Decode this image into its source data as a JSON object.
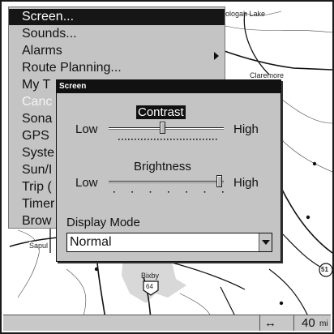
{
  "menu": {
    "items": [
      {
        "label": "Screen...",
        "state": "selected"
      },
      {
        "label": "Sounds...",
        "state": "normal"
      },
      {
        "label": "Alarms",
        "state": "normal",
        "has_submenu": true
      },
      {
        "label": "Route Planning...",
        "state": "normal"
      },
      {
        "label": "My T",
        "state": "normal"
      },
      {
        "label": "Canc",
        "state": "disabled"
      },
      {
        "label": "Sona",
        "state": "normal"
      },
      {
        "label": "GPS",
        "state": "normal"
      },
      {
        "label": "Syste",
        "state": "normal"
      },
      {
        "label": "Sun/I",
        "state": "normal"
      },
      {
        "label": "Trip (",
        "state": "normal"
      },
      {
        "label": "Timer",
        "state": "normal"
      },
      {
        "label": "Brow",
        "state": "normal"
      }
    ]
  },
  "dialog": {
    "title": "Screen",
    "contrast": {
      "label": "Contrast",
      "low_label": "Low",
      "high_label": "High",
      "level": 0.47
    },
    "brightness": {
      "label": "Brightness",
      "low_label": "Low",
      "high_label": "High",
      "level": 1.0
    },
    "display_mode": {
      "label": "Display Mode",
      "value": "Normal"
    }
  },
  "map": {
    "labels": {
      "lake": "ologah Lake",
      "claremore": "Claremore",
      "sapulpa": "Sapul",
      "bixby": "Bixby",
      "highway_64": "64",
      "highway_51": "51"
    }
  },
  "status_bar": {
    "scale_value": "40",
    "scale_unit": "mi"
  },
  "colors": {
    "menu_bg": "#c4c4c4",
    "selection": "#161616",
    "status_bar": "#c8c8c8"
  }
}
